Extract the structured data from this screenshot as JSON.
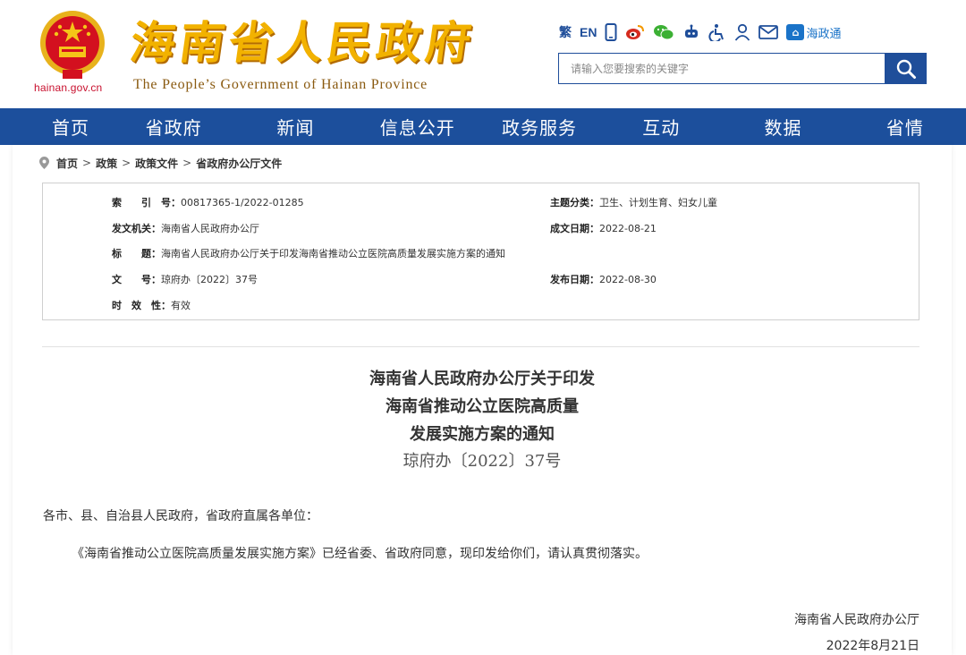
{
  "header": {
    "domain": "hainan.gov.cn",
    "site_title": "海南省人民政府",
    "site_subtitle": "The People’s Government  of Hainan Province",
    "lang_traditional": "繁",
    "lang_en": "EN",
    "hzt_label": "海政通",
    "search_placeholder": "请输入您要搜索的关键字"
  },
  "colors": {
    "nav_bg": "#1c4f9c",
    "brand_red": "#c8102e",
    "title_gold": "#f2b200"
  },
  "nav": {
    "items": [
      "首页",
      "省政府",
      "新闻",
      "信息公开",
      "政务服务",
      "互动",
      "数据",
      "省情"
    ]
  },
  "breadcrumb": [
    "首页",
    "政策",
    "政策文件",
    "省政府办公厅文件"
  ],
  "meta": {
    "index_label": "索　　引　号：",
    "index_value": "00817365-1/2022-01285",
    "category_label": "主题分类：",
    "category_value": "卫生、计划生育、妇女儿童",
    "issuer_label": "发文机关：",
    "issuer_value": "海南省人民政府办公厅",
    "created_label": "成文日期：",
    "created_value": "2022-08-21",
    "title_label": "标　　题：",
    "title_value": "海南省人民政府办公厅关于印发海南省推动公立医院高质量发展实施方案的通知",
    "docno_label": "文　　号：",
    "docno_value": "琼府办〔2022〕37号",
    "published_label": "发布日期：",
    "published_value": "2022-08-30",
    "validity_label": "时　效　性：",
    "validity_value": "有效"
  },
  "document": {
    "title_line1": "海南省人民政府办公厅关于印发",
    "title_line2": "海南省推动公立医院高质量",
    "title_line3": "发展实施方案的通知",
    "number": "琼府办〔2022〕37号",
    "salutation": "各市、县、自治县人民政府，省政府直属各单位：",
    "body": "《海南省推动公立医院高质量发展实施方案》已经省委、省政府同意，现印发给你们，请认真贯彻落实。",
    "signer": "海南省人民政府办公厅",
    "date": "2022年8月21日"
  }
}
